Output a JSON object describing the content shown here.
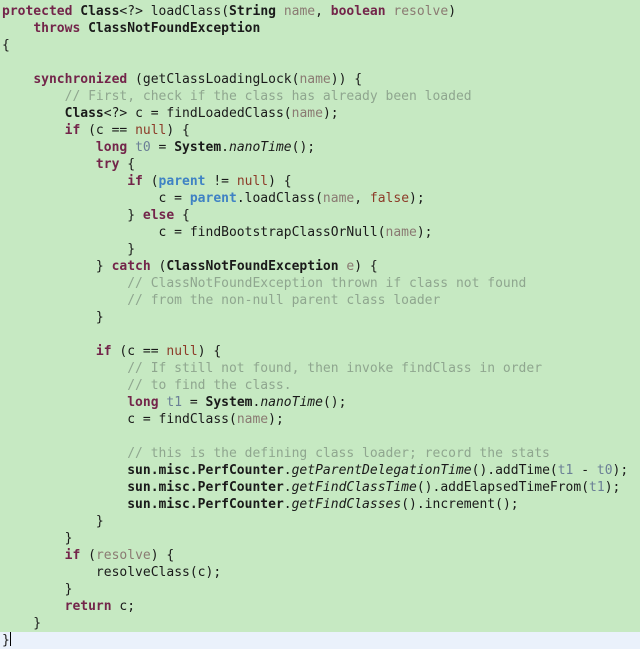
{
  "editor": {
    "language": "Java",
    "background_color": "#c6e9c2",
    "current_line_color": "#eaf1fb",
    "cursor_line_index": 38,
    "colors": {
      "keyword": "#73254a",
      "literal": "#8c3b28",
      "parameter": "#8a7a72",
      "field": "#3f82c4",
      "local_variable": "#6b7f96",
      "comment": "#8fa68f",
      "plain_text": "#1a1a1a"
    },
    "lines": [
      {
        "n": 1,
        "segments": [
          {
            "t": "protected",
            "c": "kw"
          },
          {
            "t": " ",
            "c": "plain"
          },
          {
            "t": "Class",
            "c": "type"
          },
          {
            "t": "<?> ",
            "c": "plain"
          },
          {
            "t": "loadClass",
            "c": "mcall"
          },
          {
            "t": "(",
            "c": "plain"
          },
          {
            "t": "String",
            "c": "type"
          },
          {
            "t": " ",
            "c": "plain"
          },
          {
            "t": "name",
            "c": "param"
          },
          {
            "t": ", ",
            "c": "plain"
          },
          {
            "t": "boolean",
            "c": "kw"
          },
          {
            "t": " ",
            "c": "plain"
          },
          {
            "t": "resolve",
            "c": "param"
          },
          {
            "t": ")",
            "c": "plain"
          }
        ]
      },
      {
        "n": 2,
        "segments": [
          {
            "t": "    ",
            "c": "plain"
          },
          {
            "t": "throws",
            "c": "kw"
          },
          {
            "t": " ",
            "c": "plain"
          },
          {
            "t": "ClassNotFoundException",
            "c": "type"
          }
        ]
      },
      {
        "n": 3,
        "segments": [
          {
            "t": "{",
            "c": "plain"
          }
        ]
      },
      {
        "n": 4,
        "segments": []
      },
      {
        "n": 5,
        "segments": [
          {
            "t": "    ",
            "c": "plain"
          },
          {
            "t": "synchronized",
            "c": "kw"
          },
          {
            "t": " (",
            "c": "plain"
          },
          {
            "t": "getClassLoadingLock",
            "c": "mcall"
          },
          {
            "t": "(",
            "c": "plain"
          },
          {
            "t": "name",
            "c": "param"
          },
          {
            "t": ")) {",
            "c": "plain"
          }
        ]
      },
      {
        "n": 6,
        "segments": [
          {
            "t": "        // First, check if the class has already been loaded",
            "c": "cmt"
          }
        ]
      },
      {
        "n": 7,
        "segments": [
          {
            "t": "        ",
            "c": "plain"
          },
          {
            "t": "Class",
            "c": "type"
          },
          {
            "t": "<?> c = ",
            "c": "plain"
          },
          {
            "t": "findLoadedClass",
            "c": "mcall"
          },
          {
            "t": "(",
            "c": "plain"
          },
          {
            "t": "name",
            "c": "param"
          },
          {
            "t": ");",
            "c": "plain"
          }
        ]
      },
      {
        "n": 8,
        "segments": [
          {
            "t": "        ",
            "c": "plain"
          },
          {
            "t": "if",
            "c": "kw"
          },
          {
            "t": " (c == ",
            "c": "plain"
          },
          {
            "t": "null",
            "c": "lit"
          },
          {
            "t": ") {",
            "c": "plain"
          }
        ]
      },
      {
        "n": 9,
        "segments": [
          {
            "t": "            ",
            "c": "plain"
          },
          {
            "t": "long",
            "c": "kw"
          },
          {
            "t": " ",
            "c": "plain"
          },
          {
            "t": "t0",
            "c": "local"
          },
          {
            "t": " = ",
            "c": "plain"
          },
          {
            "t": "System",
            "c": "type"
          },
          {
            "t": ".",
            "c": "plain"
          },
          {
            "t": "nanoTime",
            "c": "static"
          },
          {
            "t": "();",
            "c": "plain"
          }
        ]
      },
      {
        "n": 10,
        "segments": [
          {
            "t": "            ",
            "c": "plain"
          },
          {
            "t": "try",
            "c": "kw"
          },
          {
            "t": " {",
            "c": "plain"
          }
        ]
      },
      {
        "n": 11,
        "segments": [
          {
            "t": "                ",
            "c": "plain"
          },
          {
            "t": "if",
            "c": "kw"
          },
          {
            "t": " (",
            "c": "plain"
          },
          {
            "t": "parent",
            "c": "field"
          },
          {
            "t": " != ",
            "c": "plain"
          },
          {
            "t": "null",
            "c": "lit"
          },
          {
            "t": ") {",
            "c": "plain"
          }
        ]
      },
      {
        "n": 12,
        "segments": [
          {
            "t": "                    c = ",
            "c": "plain"
          },
          {
            "t": "parent",
            "c": "field"
          },
          {
            "t": ".",
            "c": "plain"
          },
          {
            "t": "loadClass",
            "c": "mcall"
          },
          {
            "t": "(",
            "c": "plain"
          },
          {
            "t": "name",
            "c": "param"
          },
          {
            "t": ", ",
            "c": "plain"
          },
          {
            "t": "false",
            "c": "lit"
          },
          {
            "t": ");",
            "c": "plain"
          }
        ]
      },
      {
        "n": 13,
        "segments": [
          {
            "t": "                } ",
            "c": "plain"
          },
          {
            "t": "else",
            "c": "kw"
          },
          {
            "t": " {",
            "c": "plain"
          }
        ]
      },
      {
        "n": 14,
        "segments": [
          {
            "t": "                    c = ",
            "c": "plain"
          },
          {
            "t": "findBootstrapClassOrNull",
            "c": "mcall"
          },
          {
            "t": "(",
            "c": "plain"
          },
          {
            "t": "name",
            "c": "param"
          },
          {
            "t": ");",
            "c": "plain"
          }
        ]
      },
      {
        "n": 15,
        "segments": [
          {
            "t": "                }",
            "c": "plain"
          }
        ]
      },
      {
        "n": 16,
        "segments": [
          {
            "t": "            } ",
            "c": "plain"
          },
          {
            "t": "catch",
            "c": "kw"
          },
          {
            "t": " (",
            "c": "plain"
          },
          {
            "t": "ClassNotFoundException",
            "c": "type"
          },
          {
            "t": " ",
            "c": "plain"
          },
          {
            "t": "e",
            "c": "param"
          },
          {
            "t": ") {",
            "c": "plain"
          }
        ]
      },
      {
        "n": 17,
        "segments": [
          {
            "t": "                // ClassNotFoundException thrown if class not found",
            "c": "cmt"
          }
        ]
      },
      {
        "n": 18,
        "segments": [
          {
            "t": "                // from the non-null parent class loader",
            "c": "cmt"
          }
        ]
      },
      {
        "n": 19,
        "segments": [
          {
            "t": "            }",
            "c": "plain"
          }
        ]
      },
      {
        "n": 20,
        "segments": []
      },
      {
        "n": 21,
        "segments": [
          {
            "t": "            ",
            "c": "plain"
          },
          {
            "t": "if",
            "c": "kw"
          },
          {
            "t": " (c == ",
            "c": "plain"
          },
          {
            "t": "null",
            "c": "lit"
          },
          {
            "t": ") {",
            "c": "plain"
          }
        ]
      },
      {
        "n": 22,
        "segments": [
          {
            "t": "                // If still not found, then invoke findClass in order",
            "c": "cmt"
          }
        ]
      },
      {
        "n": 23,
        "segments": [
          {
            "t": "                // to find the class.",
            "c": "cmt"
          }
        ]
      },
      {
        "n": 24,
        "segments": [
          {
            "t": "                ",
            "c": "plain"
          },
          {
            "t": "long",
            "c": "kw"
          },
          {
            "t": " ",
            "c": "plain"
          },
          {
            "t": "t1",
            "c": "local"
          },
          {
            "t": " = ",
            "c": "plain"
          },
          {
            "t": "System",
            "c": "type"
          },
          {
            "t": ".",
            "c": "plain"
          },
          {
            "t": "nanoTime",
            "c": "static"
          },
          {
            "t": "();",
            "c": "plain"
          }
        ]
      },
      {
        "n": 25,
        "segments": [
          {
            "t": "                c = ",
            "c": "plain"
          },
          {
            "t": "findClass",
            "c": "mcall"
          },
          {
            "t": "(",
            "c": "plain"
          },
          {
            "t": "name",
            "c": "param"
          },
          {
            "t": ");",
            "c": "plain"
          }
        ]
      },
      {
        "n": 26,
        "segments": []
      },
      {
        "n": 27,
        "segments": [
          {
            "t": "                // this is the defining class loader; record the stats",
            "c": "cmt"
          }
        ]
      },
      {
        "n": 28,
        "segments": [
          {
            "t": "                ",
            "c": "plain"
          },
          {
            "t": "sun.misc.PerfCounter",
            "c": "pkg"
          },
          {
            "t": ".",
            "c": "plain"
          },
          {
            "t": "getParentDelegationTime",
            "c": "static"
          },
          {
            "t": "().",
            "c": "plain"
          },
          {
            "t": "addTime",
            "c": "mcall"
          },
          {
            "t": "(",
            "c": "plain"
          },
          {
            "t": "t1",
            "c": "local"
          },
          {
            "t": " - ",
            "c": "plain"
          },
          {
            "t": "t0",
            "c": "local"
          },
          {
            "t": ");",
            "c": "plain"
          }
        ]
      },
      {
        "n": 29,
        "segments": [
          {
            "t": "                ",
            "c": "plain"
          },
          {
            "t": "sun.misc.PerfCounter",
            "c": "pkg"
          },
          {
            "t": ".",
            "c": "plain"
          },
          {
            "t": "getFindClassTime",
            "c": "static"
          },
          {
            "t": "().",
            "c": "plain"
          },
          {
            "t": "addElapsedTimeFrom",
            "c": "mcall"
          },
          {
            "t": "(",
            "c": "plain"
          },
          {
            "t": "t1",
            "c": "local"
          },
          {
            "t": ");",
            "c": "plain"
          }
        ]
      },
      {
        "n": 30,
        "segments": [
          {
            "t": "                ",
            "c": "plain"
          },
          {
            "t": "sun.misc.PerfCounter",
            "c": "pkg"
          },
          {
            "t": ".",
            "c": "plain"
          },
          {
            "t": "getFindClasses",
            "c": "static"
          },
          {
            "t": "().",
            "c": "plain"
          },
          {
            "t": "increment",
            "c": "mcall"
          },
          {
            "t": "();",
            "c": "plain"
          }
        ]
      },
      {
        "n": 31,
        "segments": [
          {
            "t": "            }",
            "c": "plain"
          }
        ]
      },
      {
        "n": 32,
        "segments": [
          {
            "t": "        }",
            "c": "plain"
          }
        ]
      },
      {
        "n": 33,
        "segments": [
          {
            "t": "        ",
            "c": "plain"
          },
          {
            "t": "if",
            "c": "kw"
          },
          {
            "t": " (",
            "c": "plain"
          },
          {
            "t": "resolve",
            "c": "param"
          },
          {
            "t": ") {",
            "c": "plain"
          }
        ]
      },
      {
        "n": 34,
        "segments": [
          {
            "t": "            ",
            "c": "plain"
          },
          {
            "t": "resolveClass",
            "c": "mcall"
          },
          {
            "t": "(c);",
            "c": "plain"
          }
        ]
      },
      {
        "n": 35,
        "segments": [
          {
            "t": "        }",
            "c": "plain"
          }
        ]
      },
      {
        "n": 36,
        "segments": [
          {
            "t": "        ",
            "c": "plain"
          },
          {
            "t": "return",
            "c": "kw"
          },
          {
            "t": " c;",
            "c": "plain"
          }
        ]
      },
      {
        "n": 37,
        "segments": [
          {
            "t": "    }",
            "c": "plain"
          }
        ]
      },
      {
        "n": 38,
        "segments": [
          {
            "t": "}",
            "c": "plain"
          }
        ],
        "current": true,
        "cursor": true
      }
    ]
  }
}
